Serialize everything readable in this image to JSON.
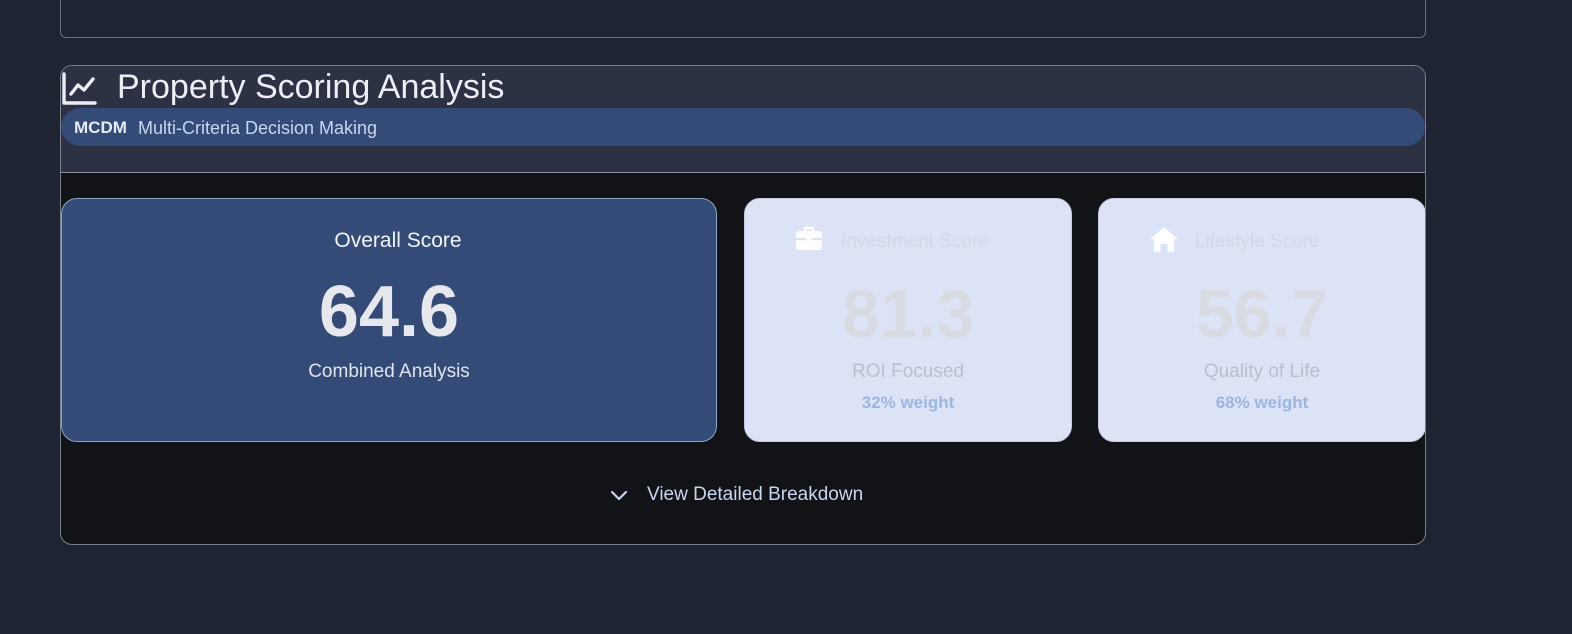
{
  "colors": {
    "page_background": "#1f2432",
    "card_background": "#121316",
    "header_background": "#2d3144",
    "accent_blue": "#334b76",
    "light_card": "#dde3f7",
    "weight_text": "#9cb6df"
  },
  "header": {
    "icon": "line-chart-icon",
    "title": "Property Scoring Analysis",
    "badge": {
      "strong": "MCDM",
      "text": "Multi-Criteria Decision Making"
    }
  },
  "scores": {
    "overall": {
      "title": "Overall Score",
      "value": "64.6",
      "subtitle": "Combined Analysis"
    },
    "investment": {
      "icon": "briefcase-icon",
      "title": "Investment Score",
      "value": "81.3",
      "subtitle": "ROI Focused",
      "weight": "32% weight"
    },
    "lifestyle": {
      "icon": "home-icon",
      "title": "Lifestyle Score",
      "value": "56.7",
      "subtitle": "Quality of Life",
      "weight": "68% weight"
    }
  },
  "breakdown": {
    "icon": "chevron-down-icon",
    "label": "View Detailed Breakdown"
  }
}
